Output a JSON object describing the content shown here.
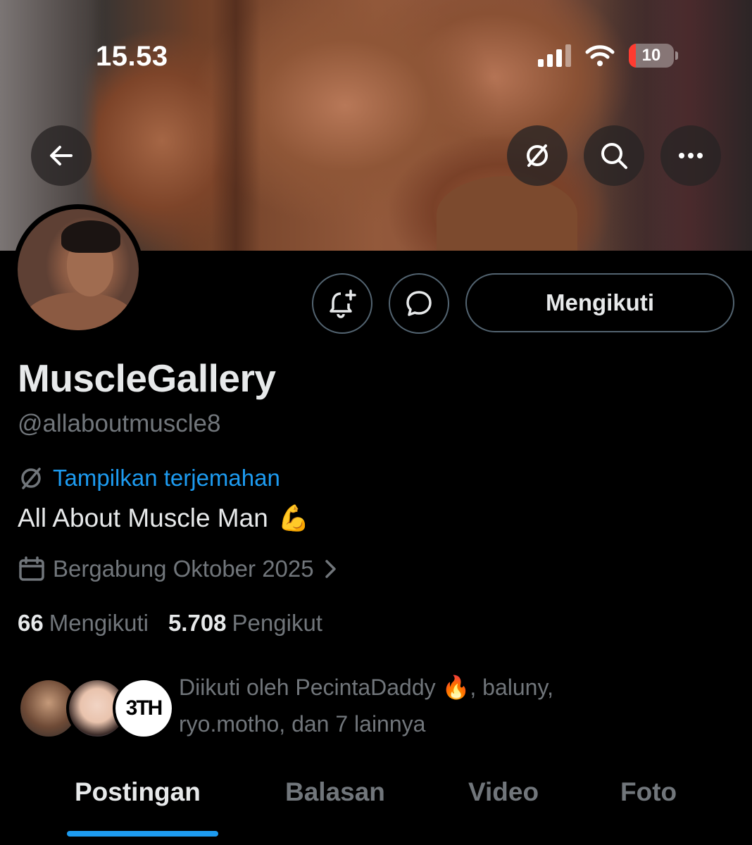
{
  "status_bar": {
    "time": "15.53",
    "battery_level": "10"
  },
  "nav": {
    "back_icon": "arrow-left-icon",
    "translate_icon": "translate-icon",
    "search_icon": "search-icon",
    "more_icon": "more-horizontal-icon"
  },
  "actions": {
    "notify_icon": "bell-plus-icon",
    "message_icon": "message-bubble-icon",
    "follow_label": "Mengikuti"
  },
  "profile": {
    "display_name": "MuscleGallery",
    "handle": "@allaboutmuscle8",
    "translate_label": "Tampilkan terjemahan",
    "bio": "All About Muscle Man",
    "bio_emoji": "💪",
    "joined": "Bergabung Oktober 2025",
    "following_count": "66",
    "following_label": "Mengikuti",
    "followers_count": "5.708",
    "followers_label": "Pengikut"
  },
  "followed_by": {
    "prefix": "Diikuti oleh PecintaDaddy",
    "emoji": "🔥",
    "rest": ", baluny, ryo.motho, dan 7 lainnya"
  },
  "tabs": [
    {
      "label": "Postingan",
      "active": true
    },
    {
      "label": "Balasan",
      "active": false
    },
    {
      "label": "Video",
      "active": false
    },
    {
      "label": "Foto",
      "active": false
    }
  ],
  "colors": {
    "accent": "#1d9bf0",
    "background": "#000000",
    "muted_text": "#71767b",
    "primary_text": "#e7e9ea",
    "battery_low": "#ff3b30"
  }
}
